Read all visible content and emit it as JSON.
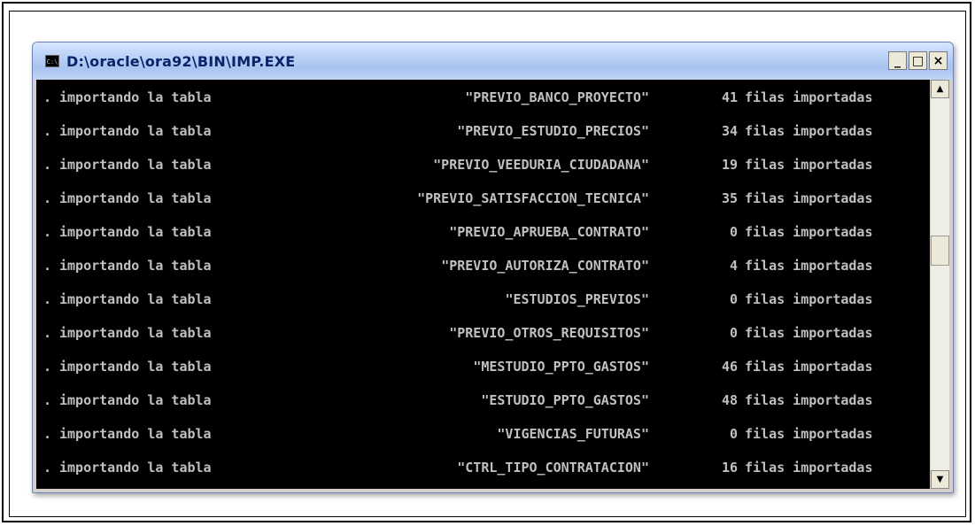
{
  "window": {
    "title": "D:\\oracle\\ora92\\BIN\\IMP.EXE",
    "icon": "console-icon",
    "icon_text": "C:\\",
    "controls": {
      "minimize": "_",
      "maximize": "□",
      "close": "×"
    }
  },
  "scrollbar": {
    "up_arrow": "▲",
    "down_arrow": "▼"
  },
  "console": {
    "lines": [
      {
        "prefix": ".",
        "action": "importando la tabla",
        "table": "\"PREVIO_BANCO_PROYECTO\"",
        "count": "41",
        "label": "filas importadas"
      },
      {
        "prefix": ".",
        "action": "importando la tabla",
        "table": "\"PREVIO_ESTUDIO_PRECIOS\"",
        "count": "34",
        "label": "filas importadas"
      },
      {
        "prefix": ".",
        "action": "importando la tabla",
        "table": "\"PREVIO_VEEDURIA_CIUDADANA\"",
        "count": "19",
        "label": "filas importadas"
      },
      {
        "prefix": ".",
        "action": "importando la tabla",
        "table": "\"PREVIO_SATISFACCION_TECNICA\"",
        "count": "35",
        "label": "filas importadas"
      },
      {
        "prefix": ".",
        "action": "importando la tabla",
        "table": "\"PREVIO_APRUEBA_CONTRATO\"",
        "count": "0",
        "label": "filas importadas"
      },
      {
        "prefix": ".",
        "action": "importando la tabla",
        "table": "\"PREVIO_AUTORIZA_CONTRATO\"",
        "count": "4",
        "label": "filas importadas"
      },
      {
        "prefix": ".",
        "action": "importando la tabla",
        "table": "\"ESTUDIOS_PREVIOS\"",
        "count": "0",
        "label": "filas importadas"
      },
      {
        "prefix": ".",
        "action": "importando la tabla",
        "table": "\"PREVIO_OTROS_REQUISITOS\"",
        "count": "0",
        "label": "filas importadas"
      },
      {
        "prefix": ".",
        "action": "importando la tabla",
        "table": "\"MESTUDIO_PPTO_GASTOS\"",
        "count": "46",
        "label": "filas importadas"
      },
      {
        "prefix": ".",
        "action": "importando la tabla",
        "table": "\"ESTUDIO_PPTO_GASTOS\"",
        "count": "48",
        "label": "filas importadas"
      },
      {
        "prefix": ".",
        "action": "importando la tabla",
        "table": "\"VIGENCIAS_FUTURAS\"",
        "count": "0",
        "label": "filas importadas"
      },
      {
        "prefix": ".",
        "action": "importando la tabla",
        "table": "\"CTRL_TIPO_CONTRATACION\"",
        "count": "16",
        "label": "filas importadas"
      }
    ]
  },
  "colors": {
    "console_bg": "#000000",
    "console_text": "#c0c0c0",
    "title_text": "#0a246a"
  }
}
